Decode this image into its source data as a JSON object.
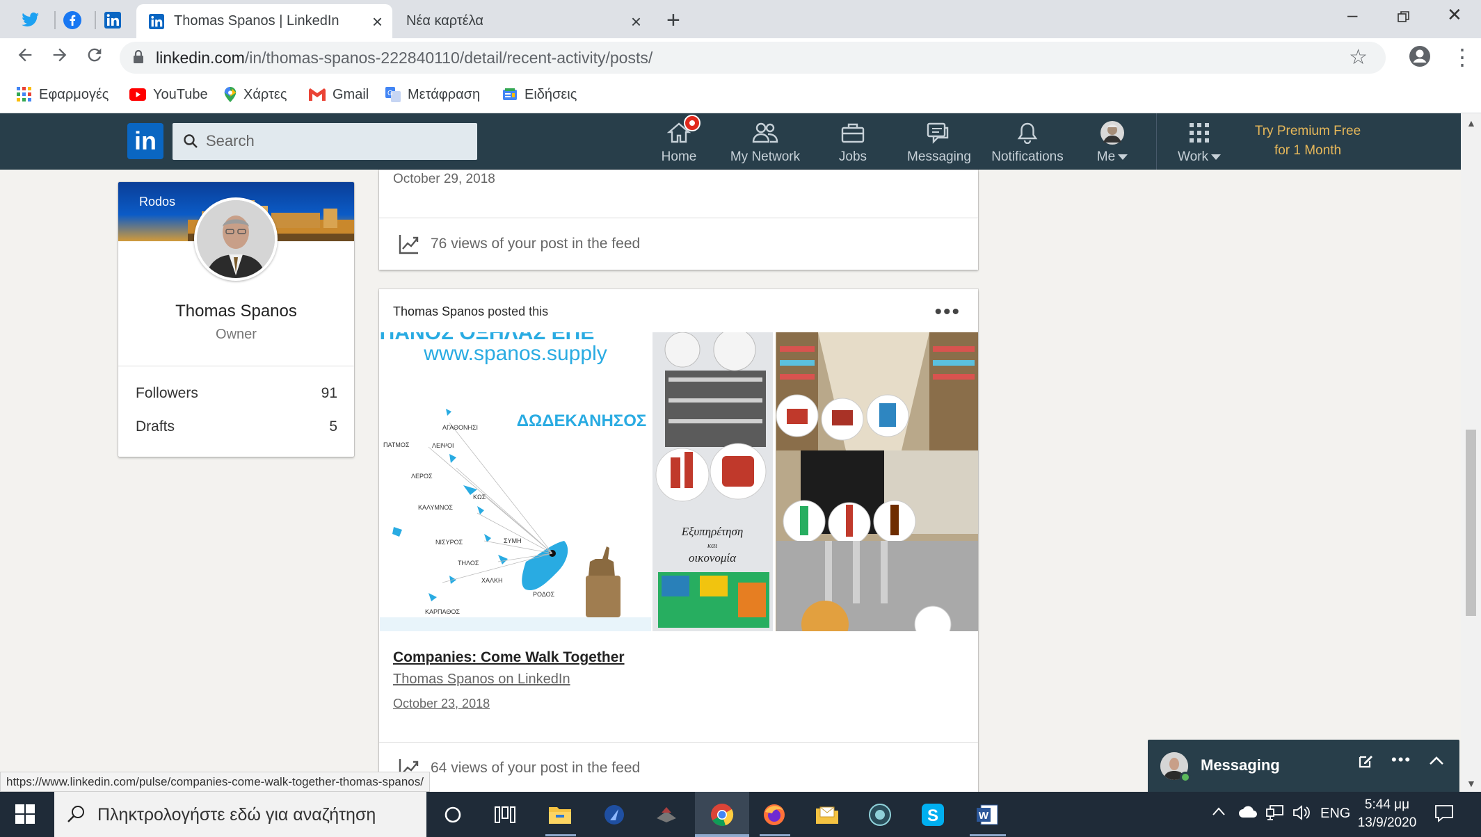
{
  "browser": {
    "tabs": [
      {
        "title": "Thomas Spanos | LinkedIn",
        "active": true
      },
      {
        "title": "Νέα καρτέλα",
        "active": false
      }
    ],
    "url_host": "linkedin.com",
    "url_path": "/in/thomas-spanos-222840110/detail/recent-activity/posts/",
    "bookmarks": [
      "Εφαρμογές",
      "YouTube",
      "Χάρτες",
      "Gmail",
      "Μετάφραση",
      "Ειδήσεις"
    ],
    "status_url": "https://www.linkedin.com/pulse/companies-come-walk-together-thomas-spanos/"
  },
  "linkedin": {
    "search_placeholder": "Search",
    "nav": {
      "home": "Home",
      "network": "My Network",
      "jobs": "Jobs",
      "messaging": "Messaging",
      "notifications": "Notifications",
      "me": "Me",
      "work": "Work"
    },
    "premium_line1": "Try Premium Free",
    "premium_line2": "for 1 Month"
  },
  "profile": {
    "cover_label": "Rodos",
    "name": "Thomas Spanos",
    "title": "Owner",
    "stats": [
      {
        "label": "Followers",
        "value": "91"
      },
      {
        "label": "Drafts",
        "value": "5"
      }
    ]
  },
  "feed": {
    "prev_post_date": "October 29, 2018",
    "prev_post_views": "76 views of your post in the feed",
    "post": {
      "author": "Thomas Spanos",
      "action": "posted this",
      "image_text": {
        "site": "www.spanos.supply",
        "region": "ΔΩΔΕΚΑΝΗΣΟΣ",
        "tagline_1": "Εξυπηρέτηση",
        "tagline_2": "και",
        "tagline_3": "οικονομία",
        "islands": [
          "ΑΓΑΘΟΝΗΣΙ",
          "ΠΑΤΜΟΣ",
          "ΛΕΙΨΟΙ",
          "ΛΕΡΟΣ",
          "ΚΑΛΥΜΝΟΣ",
          "ΚΩΣ",
          "ΝΙΣΥΡΟΣ",
          "ΣΥΜΗ",
          "ΤΗΛΟΣ",
          "ΧΑΛΚΗ",
          "ΡΟΔΟΣ",
          "ΚΑΡΠΑΘΟΣ"
        ]
      },
      "article_title": "Companies: Come Walk Together",
      "article_source": "Thomas Spanos on LinkedIn",
      "article_date": "October 23, 2018",
      "views": "64 views of your post in the feed"
    }
  },
  "messaging_widget": {
    "title": "Messaging"
  },
  "taskbar": {
    "search_placeholder": "Πληκτρολογήστε εδώ για αναζήτηση",
    "language": "ENG",
    "time": "5:44 μμ",
    "date": "13/9/2020"
  },
  "colors": {
    "linkedin_header": "#283e4a",
    "linkedin_blue": "#0a66c2",
    "premium_gold": "#e7b85a",
    "taskbar": "#1f2b38"
  }
}
